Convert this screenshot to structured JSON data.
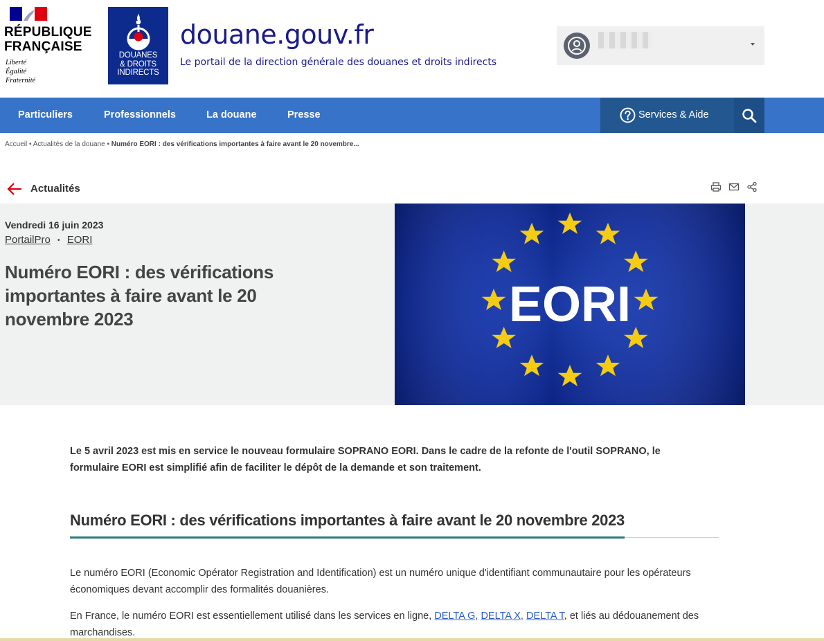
{
  "header": {
    "republique": [
      "RÉPUBLIQUE",
      "FRANÇAISE"
    ],
    "motto": [
      "Liberté",
      "Égalité",
      "Fraternité"
    ],
    "dgddi": [
      "DOUANES",
      "& DROITS",
      "INDIRECTS"
    ],
    "site_title": "douane.gouv.fr",
    "site_subtitle": "Le portail de la direction générale des douanes et droits indirects"
  },
  "nav": {
    "items": [
      "Particuliers",
      "Professionnels",
      "La douane",
      "Presse"
    ],
    "services_label": "Services & Aide"
  },
  "breadcrumb": {
    "home": "Accueil",
    "section": "Actualités de la douane",
    "current": "Numéro EORI : des vérifications importantes à faire avant le 20 novembre..."
  },
  "back": {
    "label": "Actualités"
  },
  "article": {
    "date": "Vendredi 16 juin 2023",
    "tags": [
      "PortailPro",
      "EORI"
    ],
    "title": "Numéro EORI : des vérifications importantes à faire avant le 20 novembre 2023",
    "image_text": "EORI",
    "lead": "Le 5 avril 2023 est mis en service le nouveau formulaire SOPRANO EORI. Dans le cadre de la refonte de l'outil SOPRANO, le formulaire EORI est simplifié afin de faciliter le dépôt de la demande et son traitement.",
    "section_title": "Numéro EORI : des vérifications importantes à faire avant le 20 novembre 2023",
    "para1": "Le numéro EORI (Economic Opérator Registration and Identification) est un numéro unique d'identifiant communautaire pour les opérateurs économiques devant accomplir des formalités douanières.",
    "para2_before": "En France, le numéro EORI est essentiellement utilisé dans les services en ligne, ",
    "para2_links": [
      "DELTA G,",
      "DELTA X,",
      "DELTA T"
    ],
    "para2_after": ", et liés au dédouanement des marchandises."
  },
  "colors": {
    "nav_blue": "#3673c9",
    "services_blue": "#23578f",
    "title_blue": "#1a1a8c",
    "accent_teal": "#2a7a78",
    "back_arrow_red": "#e1000f"
  }
}
